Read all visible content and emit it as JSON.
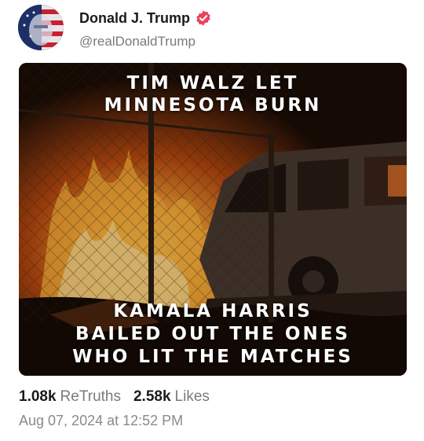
{
  "post": {
    "author_name": "Donald J. Trump",
    "handle": "@realDonaldTrump",
    "verified_icon": "verified-badge-icon",
    "image_caption_top": [
      "TIM WALZ LET",
      "MINNESOTA BURN"
    ],
    "image_caption_bottom": [
      "KAMALA HARRIS",
      "BAILED OUT THE ONES",
      "WHO LIT THE MATCHES"
    ],
    "retruths_count": "1.08k",
    "retruths_label": "ReTruths",
    "likes_count": "2.58k",
    "likes_label": "Likes",
    "timestamp": "Aug 07, 2024 at 12:52 PM"
  },
  "colors": {
    "verified": "#e8445a",
    "text_primary": "#1a1a1a",
    "text_secondary": "#7a7a7a"
  }
}
